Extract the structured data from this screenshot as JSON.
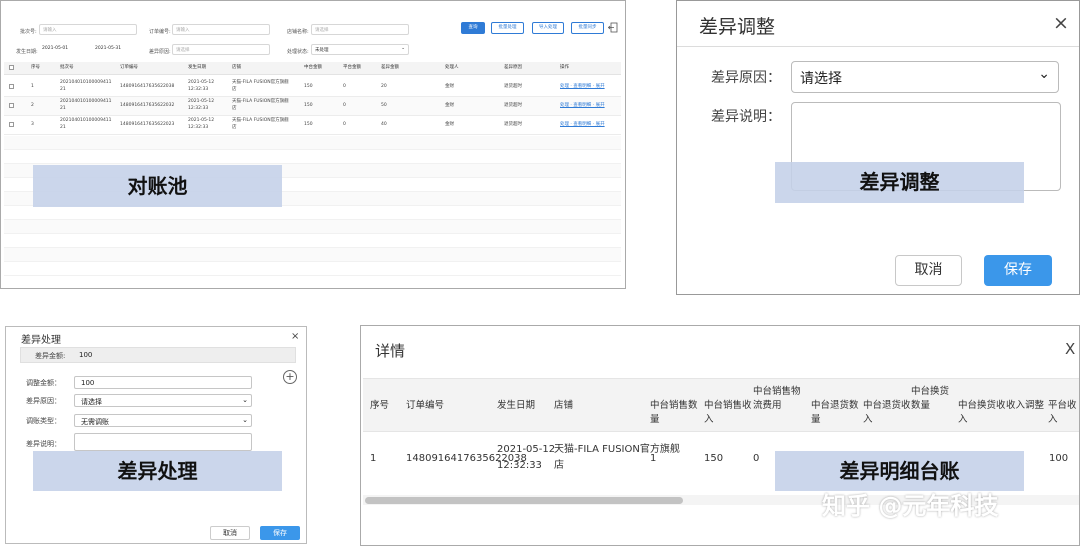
{
  "pool": {
    "filters": {
      "batch_no_label": "批次号:",
      "batch_no_placeholder": "请输入",
      "order_no_label": "订单编号:",
      "order_no_placeholder": "请输入",
      "shop_label": "店铺名称:",
      "shop_placeholder": "请选择",
      "date_label": "发生日期:",
      "date_from": "2021-05-01",
      "date_to": "2021-05-31",
      "reason_label": "差异原因:",
      "reason_placeholder": "请选择",
      "status_label": "处理状态:",
      "status_value": "未处理"
    },
    "buttons": {
      "query": "查询",
      "batch_process": "批量处理",
      "import_process": "导入处理",
      "batch_export": "批量同步"
    },
    "columns": [
      "序号",
      "批次号",
      "订单编号",
      "发生日期",
      "店铺",
      "中台金额",
      "平台金额",
      "差异金额",
      "处理人",
      "差异原因",
      "操作"
    ],
    "rows": [
      {
        "no": "1",
        "batch": "202104010100009411",
        "batch2": "21",
        "order": "1480916417635622038",
        "date": "2021-05-12",
        "time": "12:32:33",
        "shop": "天猫-FILA FUSION官方旗舰",
        "shop2": "店",
        "mid": "150",
        "plat": "0",
        "diff": "20",
        "handler": "金财",
        "reason": "退货超时",
        "action": "处理 · 查看明细 · 展开"
      },
      {
        "no": "2",
        "batch": "202104010100009411",
        "batch2": "21",
        "order": "1480916417635622032",
        "date": "2021-05-12",
        "time": "12:32:33",
        "shop": "天猫-FILA FUSION官方旗舰",
        "shop2": "店",
        "mid": "150",
        "plat": "0",
        "diff": "50",
        "handler": "金财",
        "reason": "退货超时",
        "action": "处理 · 查看明细 · 展开"
      },
      {
        "no": "3",
        "batch": "202104010100009411",
        "batch2": "21",
        "order": "1480916417635622023",
        "date": "2021-05-12",
        "time": "12:32:33",
        "shop": "天猫-FILA FUSION官方旗舰",
        "shop2": "店",
        "mid": "150",
        "plat": "0",
        "diff": "40",
        "handler": "金财",
        "reason": "退货超时",
        "action": "处理 · 查看明细 · 展开"
      }
    ],
    "overlay": "对账池"
  },
  "adjust": {
    "title": "差异调整",
    "close": "×",
    "reason_label": "差异原因：",
    "reason_value": "请选择",
    "desc_label": "差异说明：",
    "cancel": "取消",
    "save": "保存",
    "overlay": "差异调整"
  },
  "process": {
    "title": "差异处理",
    "close": "×",
    "amount_label": "差异金额:",
    "amount_value": "100",
    "adjust_amount_label": "调整金额：",
    "adjust_amount_value": "100",
    "reason_label": "差异原因：",
    "reason_value": "请选择",
    "type_label": "调账类型：",
    "type_value": "无需调账",
    "desc_label": "差异说明：",
    "cancel": "取消",
    "save": "保存",
    "overlay": "差异处理"
  },
  "detail": {
    "title": "详情",
    "close": "X",
    "columns": [
      "序号",
      "订单编号",
      "发生日期",
      "店铺",
      "中台销售数量",
      "中台销售收入",
      "中台销售物流费用",
      "中台退货数量",
      "中台退货收入",
      "中台换货数量",
      "中台换货收入",
      "收入调整",
      "平台收入"
    ],
    "row": {
      "no": "1",
      "order": "1480916417635622038",
      "date": "2021-05-12",
      "time": "12:32:33",
      "shop": "天猫-FILA FUSION官方旗舰",
      "shop2": "店",
      "qty": "1",
      "income": "150",
      "logistics": "0",
      "platform_income": "100"
    },
    "overlay": "差异明细台账"
  },
  "watermark": "知乎 @元年科技"
}
